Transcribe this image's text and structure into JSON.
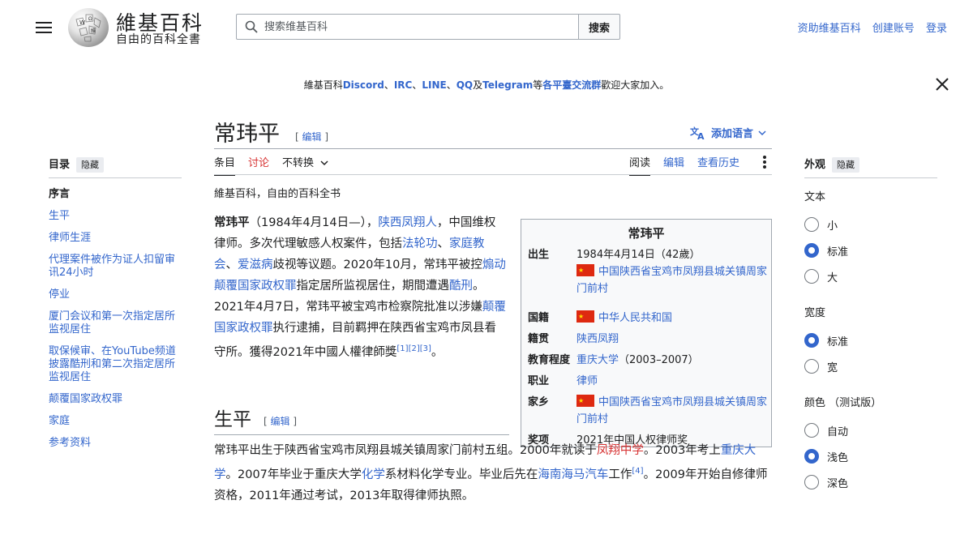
{
  "header": {
    "site_title": "維基百科",
    "tagline": "自由的百科全書",
    "search_placeholder": "搜索维基百科",
    "search_button": "搜索",
    "links": [
      "资助维基百科",
      "创建账号",
      "登录"
    ]
  },
  "banner": {
    "parts": [
      {
        "text": "維基百科",
        "link": false
      },
      {
        "text": "Discord",
        "link": true
      },
      {
        "text": "、",
        "link": false
      },
      {
        "text": "IRC",
        "link": true
      },
      {
        "text": "、",
        "link": false
      },
      {
        "text": "LINE",
        "link": true
      },
      {
        "text": "、",
        "link": false
      },
      {
        "text": "QQ",
        "link": true
      },
      {
        "text": "及",
        "link": false
      },
      {
        "text": "Telegram",
        "link": true
      },
      {
        "text": "等",
        "link": false
      },
      {
        "text": "各平臺交流群",
        "link": true
      },
      {
        "text": "歡迎大家加入。",
        "link": false
      }
    ]
  },
  "article": {
    "title": "常玮平",
    "edit_label": "编辑",
    "add_languages": "添加语言",
    "tabs_left": [
      "条目",
      "讨论",
      "不转换"
    ],
    "tabs_right": [
      "阅读",
      "编辑",
      "查看历史"
    ],
    "from": "維基百科，自由的百科全书",
    "lead": [
      {
        "t": "常玮平",
        "s": "b"
      },
      {
        "t": "（1984年4月14日—），",
        "s": ""
      },
      {
        "t": "陕西凤翔人",
        "s": "a"
      },
      {
        "t": "，中国维权律师。多次代理敏感人权案件，包括",
        "s": ""
      },
      {
        "t": "法轮功",
        "s": "a"
      },
      {
        "t": "、",
        "s": ""
      },
      {
        "t": "家庭教会",
        "s": "a"
      },
      {
        "t": "、",
        "s": ""
      },
      {
        "t": "爱滋病",
        "s": "a"
      },
      {
        "t": "歧视等议题。2020年10月，常玮平被控",
        "s": ""
      },
      {
        "t": "煽动颠覆国家政权罪",
        "s": "a"
      },
      {
        "t": "指定居所监视居住，期間遭遇",
        "s": ""
      },
      {
        "t": "酷刑",
        "s": "a"
      },
      {
        "t": "。2021年4月7日，常玮平被宝鸡市检察院批准以涉嫌",
        "s": ""
      },
      {
        "t": "颠覆国家政权罪",
        "s": "a"
      },
      {
        "t": "执行逮捕，目前羁押在陕西省宝鸡市凤县看守所。獲得2021年中國人權律師獎",
        "s": ""
      },
      {
        "t": "[1][2][3]",
        "s": "sup"
      },
      {
        "t": "。",
        "s": ""
      }
    ],
    "section": {
      "heading": "生平",
      "edit_label": "编辑",
      "para": [
        {
          "t": "常玮平出生于陕西省宝鸡市凤翔县城关镇周家门前村五组。2000年就读于",
          "s": ""
        },
        {
          "t": "凤翔中学",
          "s": "r"
        },
        {
          "t": "。2003年考上",
          "s": ""
        },
        {
          "t": "重庆大学",
          "s": "a"
        },
        {
          "t": "。2007年毕业于重庆大学",
          "s": ""
        },
        {
          "t": "化学",
          "s": "a"
        },
        {
          "t": "系材料化学专业。毕业后先在",
          "s": ""
        },
        {
          "t": "海南海马汽车",
          "s": "a"
        },
        {
          "t": "工作",
          "s": ""
        },
        {
          "t": "[4]",
          "s": "sup"
        },
        {
          "t": "。2009年开始自修律师资格，2011年通过考试，2013年取得律师执照。",
          "s": ""
        }
      ]
    }
  },
  "toc": {
    "title": "目录",
    "hide": "隐藏",
    "items": [
      "序言",
      "生平",
      "律师生涯",
      "代理案件被作为证人扣留审讯24小时",
      "停业",
      "厦门会议和第一次指定居所监视居住",
      "取保候审、在YouTube频道披露酷刑和第二次指定居所监视居住",
      "颠覆国家政权罪",
      "家庭",
      "参考资料"
    ]
  },
  "appearance": {
    "title": "外观",
    "hide": "隐藏",
    "groups": [
      {
        "label": "文本",
        "options": [
          "小",
          "标准",
          "大"
        ],
        "selected": 1
      },
      {
        "label": "宽度",
        "options": [
          "标准",
          "宽"
        ],
        "selected": 0
      },
      {
        "label": "颜色 （测试版）",
        "options": [
          "自动",
          "浅色",
          "深色"
        ],
        "selected": 1
      }
    ]
  },
  "infobox": {
    "title": "常玮平",
    "rows": [
      {
        "k": "出生",
        "v": "1984年4月14日（42歲）",
        "v2": "中国陕西省宝鸡市凤翔县城关镇周家门前村",
        "flag": true
      },
      {
        "k": "国籍",
        "v": "中华人民共和国",
        "flag": true,
        "link": true
      },
      {
        "k": "籍贯",
        "v": "陕西凤翔",
        "link": true
      },
      {
        "k": "教育程度",
        "v": "重庆大学",
        "v_suffix": "（2003–2007）",
        "link": true
      },
      {
        "k": "职业",
        "v": "律师",
        "link": true
      },
      {
        "k": "家乡",
        "v": "中国陕西省宝鸡市凤翔县城关镇周家门前村",
        "flag": true,
        "link": true
      },
      {
        "k": "奖项",
        "v": "2021年中国人权律师奖"
      }
    ]
  }
}
